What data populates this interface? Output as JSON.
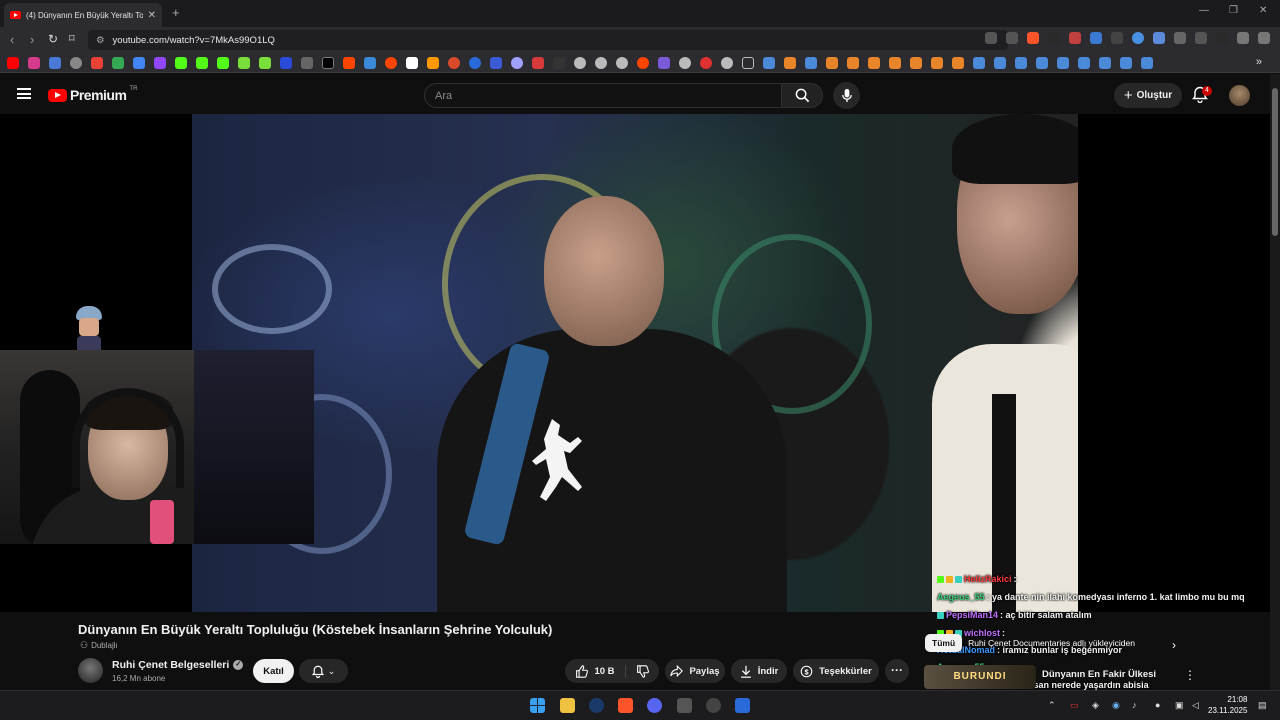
{
  "browser": {
    "tab_title": "(4) Dünyanın En Büyük Yeraltı To",
    "url": "youtube.com/watch?v=7MkAs99O1LQ",
    "new_tab": "+",
    "bookmarks_more": "»"
  },
  "header": {
    "logo_text": "Premium",
    "logo_region": "TR",
    "search_placeholder": "Ara",
    "create_label": "Oluştur",
    "notification_count": "4"
  },
  "video": {
    "title": "Dünyanın En Büyük Yeraltı Topluluğu (Köstebek İnsanların Şehrine Yolculuk)",
    "dubbed_label": "Dublajlı",
    "channel_name": "Ruhi Çenet Belgeselleri",
    "subscribers": "16,2 Mn abone",
    "join_label": "Katıl",
    "like_count": "10 B",
    "share_label": "Paylaş",
    "download_label": "İndir",
    "thanks_label": "Teşekkürler",
    "more_label": "···"
  },
  "chat": [
    {
      "user": "HelizRakici",
      "user_color": "#ff3b3b",
      "message": ":"
    },
    {
      "user": "Aegeus_55",
      "user_color": "#3ad07a",
      "message": ": ya dante nin ilahi komedyası inferno 1. kat limbo mu bu mq"
    },
    {
      "user": "PepsiMan14",
      "user_color": "#c070ff",
      "message": ": aç bitir salam atalım"
    },
    {
      "user": "wichlost",
      "user_color": "#c070ff",
      "message": ":"
    },
    {
      "user": "ActualNomad",
      "user_color": "#3a9aff",
      "message": ": iramız bunlar iş beğenmiyor"
    },
    {
      "user": "Aegeus_55",
      "user_color": "#3ad07a",
      "message": ":"
    },
    {
      "user": "wichlost",
      "user_color": "#c070ff",
      "message": ": sen olsan nerede yaşardın abisia"
    }
  ],
  "suggestions": {
    "chip_all": "Tümü",
    "chip_uploader": "Ruhi Çenet Documentaries adlı yükleyiciden",
    "thumb_text": "BURUNDI",
    "first_title": "Dünyanın En Fakir Ülkesi"
  },
  "taskbar": {
    "time": "21:08",
    "date": "23.11.2025"
  },
  "colors": {
    "accent": "#ff0000",
    "background": "#0f0f0f",
    "surface": "#272727"
  }
}
